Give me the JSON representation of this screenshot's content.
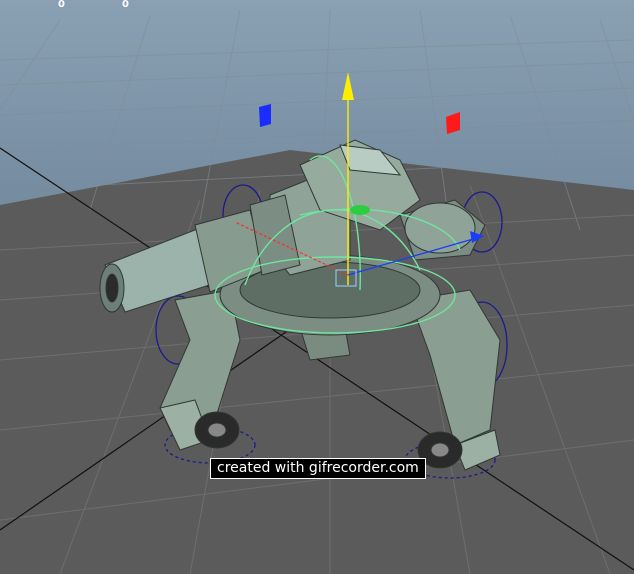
{
  "viewport": {
    "hud_counters": [
      "0",
      "0"
    ],
    "sky_color": "#7d93a6",
    "floor_color": "#5b5b5b",
    "grid_color": "#6f6f6f",
    "gizmo_axis_y_color": "#ffee00",
    "gizmo_axis_x_color": "#ff2a2a",
    "gizmo_axis_z_color": "#1a3cff",
    "gizmo_rotate_ring_color": "#6fe6a0",
    "rig_control_color": "#1a1a8f",
    "model_color": "#8a9e92"
  },
  "watermark": {
    "text": "created with gifrecorder.com"
  },
  "markers": {
    "blue_marker_icon": "blue-flag-marker",
    "red_marker_icon": "red-flag-marker"
  }
}
